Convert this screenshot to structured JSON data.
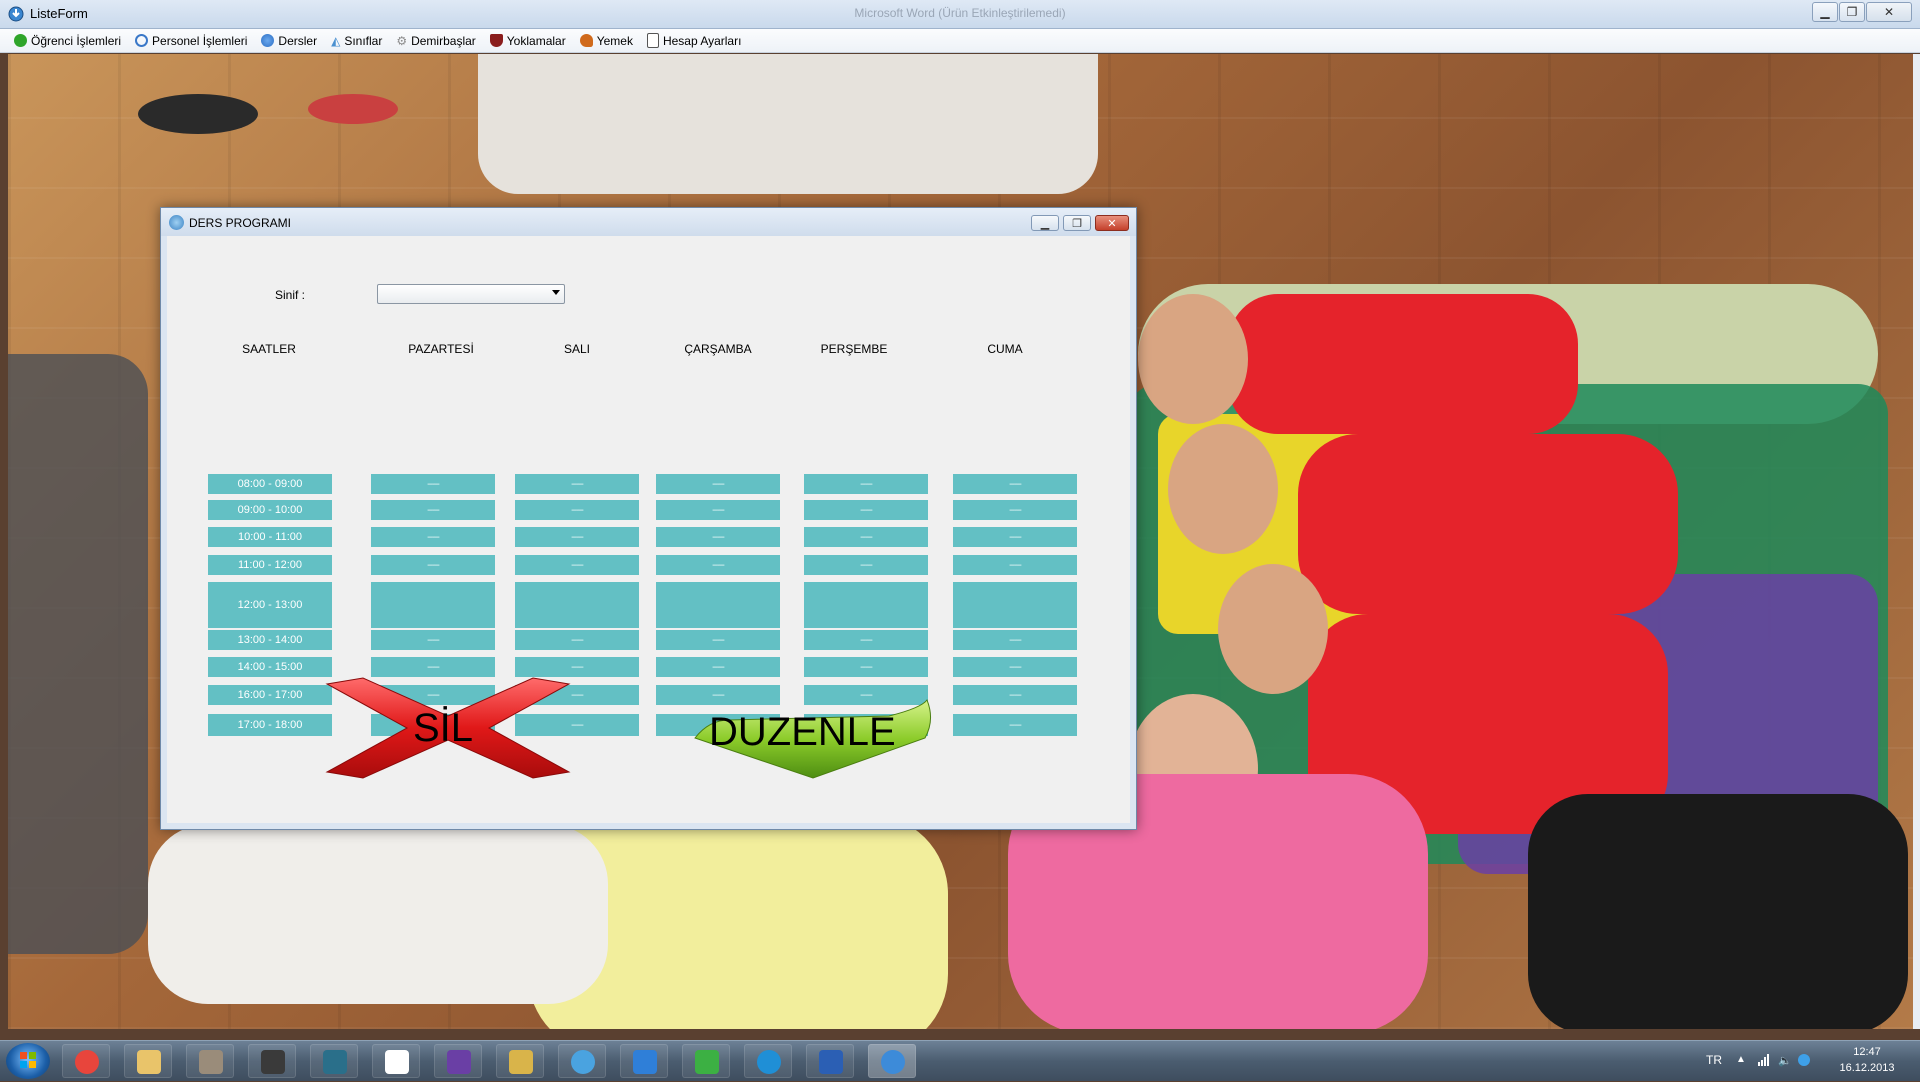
{
  "window": {
    "title": "ListeForm",
    "doc_title": "Microsoft Word (Ürün Etkinleştirilemedi)"
  },
  "menu": [
    {
      "label": "Öğrenci İşlemleri",
      "icon": "check-circle-icon",
      "color": "#2fa52a"
    },
    {
      "label": "Personel İşlemleri",
      "icon": "refresh-arrow-icon",
      "color": "#3a78c8"
    },
    {
      "label": "Dersler",
      "icon": "molecule-icon",
      "color": "#2d6fc4"
    },
    {
      "label": "Sınıflar",
      "icon": "triangle-icon",
      "color": "#4a90d0"
    },
    {
      "label": "Demirbaşlar",
      "icon": "gear-icon",
      "color": "#8a8a8a"
    },
    {
      "label": "Yoklamalar",
      "icon": "shield-icon",
      "color": "#8a1d1d"
    },
    {
      "label": "Yemek",
      "icon": "food-icon",
      "color": "#d06a1c"
    },
    {
      "label": "Hesap Ayarları",
      "icon": "document-icon",
      "color": "#555555"
    }
  ],
  "dialog": {
    "title": "DERS PROGRAMI",
    "sinif_label": "Sinif :",
    "sinif_value": "",
    "headers": [
      "SAATLER",
      "PAZARTESİ",
      "SALI",
      "ÇARŞAMBA",
      "PERŞEMBE",
      "CUMA"
    ],
    "slots": [
      "08:00 - 09:00",
      "09:00 - 10:00",
      "10:00 - 11:00",
      "11:00 - 12:00",
      "12:00 - 13:00",
      "13:00 - 14:00",
      "14:00 - 15:00",
      "16:00 - 17:00",
      "17:00 - 18:00"
    ],
    "cell_text": "-----",
    "delete_label": "SİL",
    "edit_label": "DUZENLE",
    "cell_color": "#63c0c4"
  },
  "taskbar": {
    "apps": [
      "chrome-icon",
      "explorer-icon",
      "books-icon",
      "film-icon",
      "network-icon",
      "yandex-icon",
      "visual-studio-icon",
      "tools-icon",
      "blue-app-icon",
      "app-store-icon",
      "download-arrows-icon",
      "ccleaner-icon",
      "word-icon",
      "downloader-icon"
    ],
    "lang": "TR",
    "time": "12:47",
    "date": "16.12.2013"
  }
}
